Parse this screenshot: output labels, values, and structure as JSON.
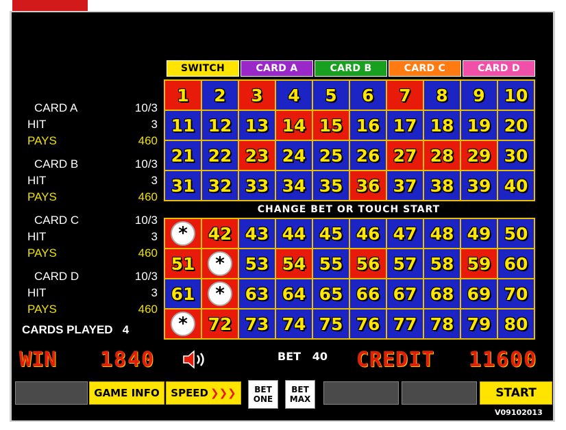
{
  "tabs": [
    {
      "label": "SWITCH",
      "bg": "#ffe400",
      "fg": "#000000"
    },
    {
      "label": "CARD A",
      "bg": "#9a28c8",
      "fg": "#ffffff"
    },
    {
      "label": "CARD B",
      "bg": "#1aa020",
      "fg": "#ffffff"
    },
    {
      "label": "CARD C",
      "bg": "#ff7a10",
      "fg": "#ffffff"
    },
    {
      "label": "CARD D",
      "bg": "#f050a8",
      "fg": "#ffffff"
    }
  ],
  "stats": [
    {
      "card": "CARD A",
      "spots": "10/3",
      "hit_label": "HIT",
      "hit": "3",
      "pays_label": "PAYS",
      "pays": "460"
    },
    {
      "card": "CARD B",
      "spots": "10/3",
      "hit_label": "HIT",
      "hit": "3",
      "pays_label": "PAYS",
      "pays": "460"
    },
    {
      "card": "CARD C",
      "spots": "10/3",
      "hit_label": "HIT",
      "hit": "3",
      "pays_label": "PAYS",
      "pays": "460"
    },
    {
      "card": "CARD D",
      "spots": "10/3",
      "hit_label": "HIT",
      "hit": "3",
      "pays_label": "PAYS",
      "pays": "460"
    }
  ],
  "cards_played": {
    "label": "CARDS PLAYED",
    "value": "4"
  },
  "message": "CHANGE BET OR TOUCH START",
  "top_grid": {
    "numbers": [
      "1",
      "2",
      "3",
      "4",
      "5",
      "6",
      "7",
      "8",
      "9",
      "10",
      "11",
      "12",
      "13",
      "14",
      "15",
      "16",
      "17",
      "18",
      "19",
      "20",
      "21",
      "22",
      "23",
      "24",
      "25",
      "26",
      "27",
      "28",
      "29",
      "30",
      "31",
      "32",
      "33",
      "34",
      "35",
      "36",
      "37",
      "38",
      "39",
      "40"
    ],
    "red": [
      "1",
      "3",
      "7",
      "14",
      "15",
      "23",
      "27",
      "28",
      "29",
      "36"
    ]
  },
  "bottom_grid": {
    "numbers": [
      "41",
      "42",
      "43",
      "44",
      "45",
      "46",
      "47",
      "48",
      "49",
      "50",
      "51",
      "52",
      "53",
      "54",
      "55",
      "56",
      "57",
      "58",
      "59",
      "60",
      "61",
      "62",
      "63",
      "64",
      "65",
      "66",
      "67",
      "68",
      "69",
      "70",
      "71",
      "72",
      "73",
      "74",
      "75",
      "76",
      "77",
      "78",
      "79",
      "80"
    ],
    "red": [
      "42",
      "51",
      "54",
      "56",
      "59",
      "72"
    ],
    "starred": [
      "41",
      "52",
      "62",
      "71"
    ],
    "star_symbol": "*"
  },
  "win": {
    "label": "WIN",
    "value": "1840"
  },
  "bet": {
    "label": "BET",
    "value": "40"
  },
  "credit": {
    "label": "CREDIT",
    "value": "11600"
  },
  "buttons": {
    "game_info": "GAME INFO",
    "speed": "SPEED",
    "speed_chevrons": "❯❯❯",
    "bet_one_1": "BET",
    "bet_one_2": "ONE",
    "bet_max_1": "BET",
    "bet_max_2": "MAX",
    "start": "START"
  },
  "version": "V09102013",
  "icons": {
    "sound": "speaker-icon"
  }
}
